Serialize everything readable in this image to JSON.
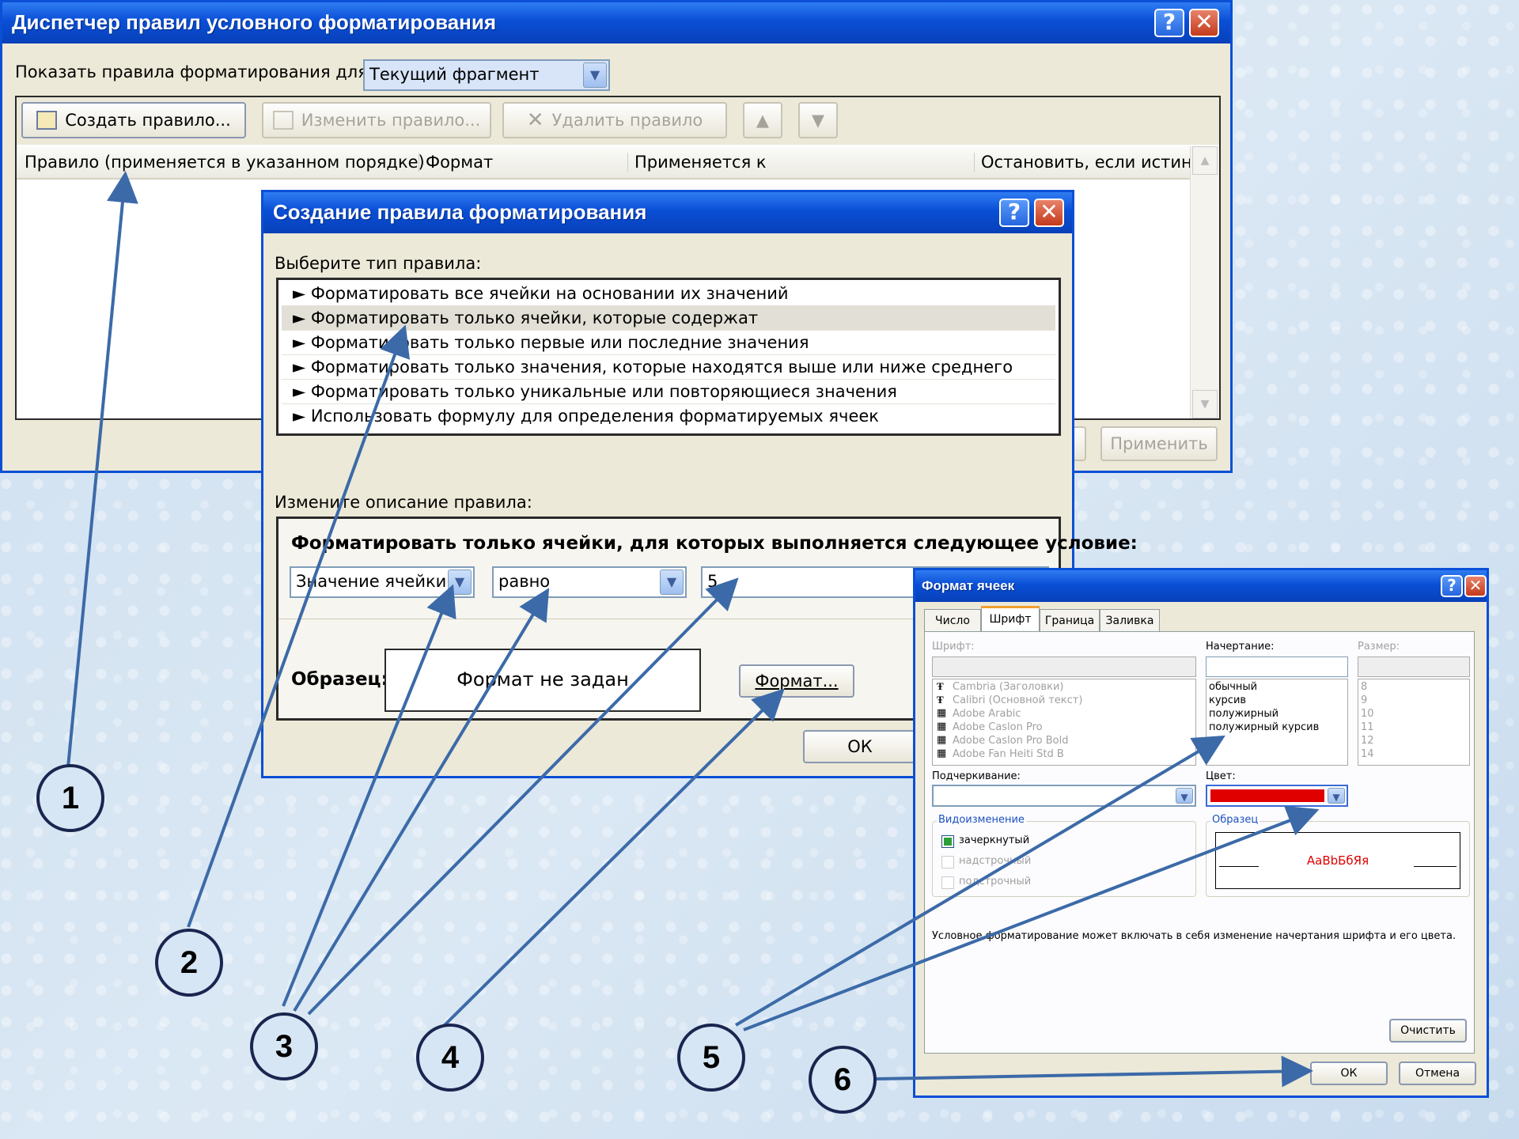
{
  "manager": {
    "title": "Диспетчер правил условного форматирования",
    "show_rules_label": "Показать правила форматирования для:",
    "show_rules_value": "Текущий фрагмент",
    "create_rule": "Создать правило...",
    "edit_rule": "Изменить правило...",
    "delete_rule": "Удалить правило",
    "columns": [
      "Правило (применяется в указанном порядке)",
      "Формат",
      "Применяется к",
      "Остановить, если истина"
    ],
    "apply_button": "Применить"
  },
  "create_dialog": {
    "title": "Создание правила форматирования",
    "choose_type_label": "Выберите тип правила:",
    "rule_types": [
      "► Форматировать все ячейки на основании их значений",
      "► Форматировать только ячейки, которые содержат",
      "► Форматировать только первые или последние значения",
      "► Форматировать только значения, которые находятся выше или ниже среднего",
      "► Форматировать только уникальные или повторяющиеся значения",
      "► Использовать формулу для определения форматируемых ячеек"
    ],
    "edit_description_label": "Измените описание правила:",
    "condition_heading": "Форматировать только ячейки, для которых выполняется следующее условие:",
    "cond_field": "Значение ячейки",
    "cond_operator": "равно",
    "cond_value": "5",
    "sample_label": "Образец:",
    "sample_text": "Формат не задан",
    "format_button": "Формат...",
    "ok_button": "ОК"
  },
  "format_cells": {
    "title": "Формат ячеек",
    "tabs": [
      "Число",
      "Шрифт",
      "Граница",
      "Заливка"
    ],
    "font_label": "Шрифт:",
    "style_label": "Начертание:",
    "size_label": "Размер:",
    "fonts": [
      "Cambria (Заголовки)",
      "Calibri (Основной текст)",
      "Adobe Arabic",
      "Adobe Caslon Pro",
      "Adobe Caslon Pro Bold",
      "Adobe Fan Heiti Std B"
    ],
    "styles": [
      "обычный",
      "курсив",
      "полужирный",
      "полужирный курсив"
    ],
    "sizes": [
      "8",
      "9",
      "10",
      "11",
      "12",
      "14"
    ],
    "underline_label": "Подчеркивание:",
    "color_label": "Цвет:",
    "color_value": "#e00000",
    "effects_label": "Видоизменение",
    "effects": [
      "зачеркнутый",
      "надстрочный",
      "подстрочный"
    ],
    "sample_label": "Образец",
    "sample_text": "AaBbБбЯя",
    "note": "Условное форматирование может включать в себя изменение начертания шрифта и его цвета.",
    "clear_button": "Очистить",
    "ok_button": "ОК",
    "cancel_button": "Отмена"
  },
  "callouts": [
    "1",
    "2",
    "3",
    "4",
    "5",
    "6"
  ]
}
